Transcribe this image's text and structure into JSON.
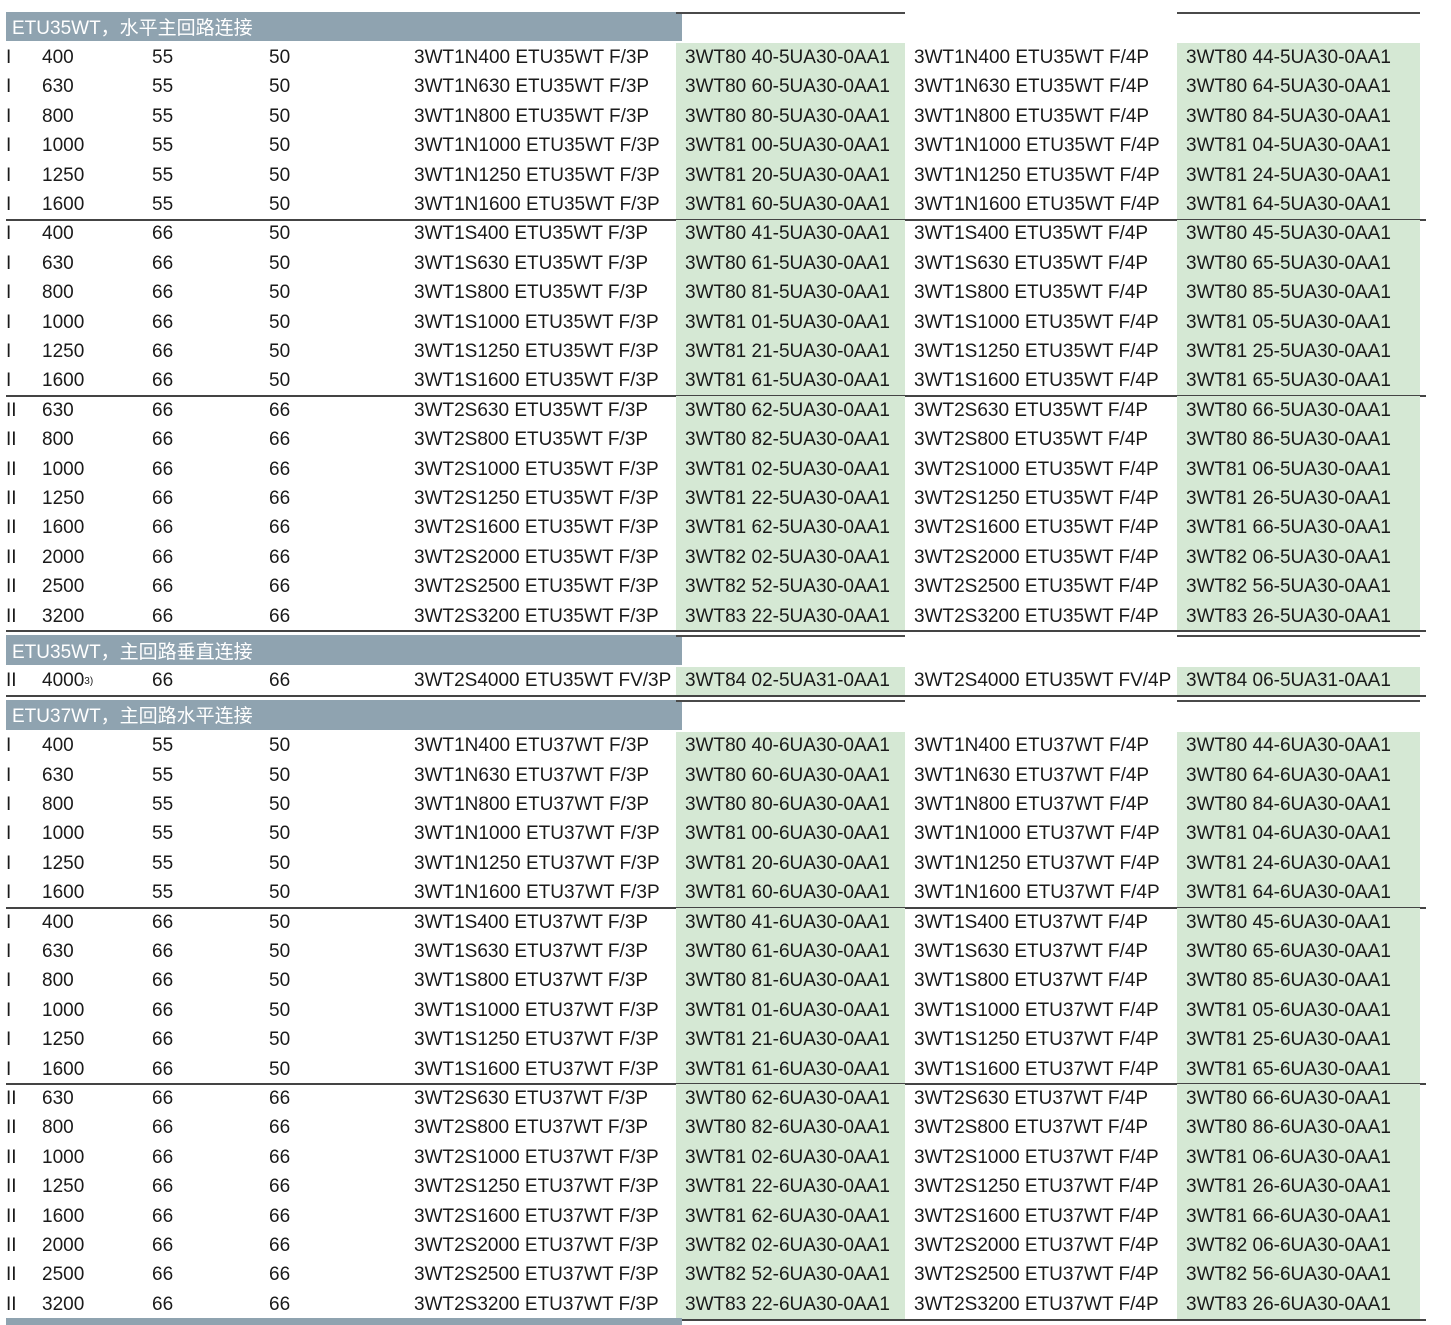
{
  "sections": [
    {
      "title": "ETU35WT，水平主回路连接",
      "groups": [
        [
          [
            "I",
            "400",
            "55",
            "50",
            "3WT1N400 ETU35WT F/3P",
            "3WT80 40-5UA30-0AA1",
            "3WT1N400 ETU35WT F/4P",
            "3WT80 44-5UA30-0AA1"
          ],
          [
            "I",
            "630",
            "55",
            "50",
            "3WT1N630 ETU35WT F/3P",
            "3WT80 60-5UA30-0AA1",
            "3WT1N630 ETU35WT F/4P",
            "3WT80 64-5UA30-0AA1"
          ],
          [
            "I",
            "800",
            "55",
            "50",
            "3WT1N800 ETU35WT F/3P",
            "3WT80 80-5UA30-0AA1",
            "3WT1N800 ETU35WT F/4P",
            "3WT80 84-5UA30-0AA1"
          ],
          [
            "I",
            "1000",
            "55",
            "50",
            "3WT1N1000 ETU35WT F/3P",
            "3WT81 00-5UA30-0AA1",
            "3WT1N1000 ETU35WT F/4P",
            "3WT81 04-5UA30-0AA1"
          ],
          [
            "I",
            "1250",
            "55",
            "50",
            "3WT1N1250 ETU35WT F/3P",
            "3WT81 20-5UA30-0AA1",
            "3WT1N1250 ETU35WT F/4P",
            "3WT81 24-5UA30-0AA1"
          ],
          [
            "I",
            "1600",
            "55",
            "50",
            "3WT1N1600 ETU35WT F/3P",
            "3WT81 60-5UA30-0AA1",
            "3WT1N1600 ETU35WT F/4P",
            "3WT81 64-5UA30-0AA1"
          ]
        ],
        [
          [
            "I",
            "400",
            "66",
            "50",
            "3WT1S400 ETU35WT F/3P",
            "3WT80 41-5UA30-0AA1",
            "3WT1S400 ETU35WT F/4P",
            "3WT80 45-5UA30-0AA1"
          ],
          [
            "I",
            "630",
            "66",
            "50",
            "3WT1S630 ETU35WT F/3P",
            "3WT80 61-5UA30-0AA1",
            "3WT1S630 ETU35WT F/4P",
            "3WT80 65-5UA30-0AA1"
          ],
          [
            "I",
            "800",
            "66",
            "50",
            "3WT1S800 ETU35WT F/3P",
            "3WT80 81-5UA30-0AA1",
            "3WT1S800 ETU35WT F/4P",
            "3WT80 85-5UA30-0AA1"
          ],
          [
            "I",
            "1000",
            "66",
            "50",
            "3WT1S1000 ETU35WT F/3P",
            "3WT81 01-5UA30-0AA1",
            "3WT1S1000 ETU35WT F/4P",
            "3WT81 05-5UA30-0AA1"
          ],
          [
            "I",
            "1250",
            "66",
            "50",
            "3WT1S1250 ETU35WT F/3P",
            "3WT81 21-5UA30-0AA1",
            "3WT1S1250 ETU35WT F/4P",
            "3WT81 25-5UA30-0AA1"
          ],
          [
            "I",
            "1600",
            "66",
            "50",
            "3WT1S1600 ETU35WT F/3P",
            "3WT81 61-5UA30-0AA1",
            "3WT1S1600 ETU35WT F/4P",
            "3WT81 65-5UA30-0AA1"
          ]
        ],
        [
          [
            "II",
            "630",
            "66",
            "66",
            "3WT2S630 ETU35WT F/3P",
            "3WT80 62-5UA30-0AA1",
            "3WT2S630 ETU35WT F/4P",
            "3WT80 66-5UA30-0AA1"
          ],
          [
            "II",
            "800",
            "66",
            "66",
            "3WT2S800 ETU35WT F/3P",
            "3WT80 82-5UA30-0AA1",
            "3WT2S800 ETU35WT F/4P",
            "3WT80 86-5UA30-0AA1"
          ],
          [
            "II",
            "1000",
            "66",
            "66",
            "3WT2S1000 ETU35WT F/3P",
            "3WT81 02-5UA30-0AA1",
            "3WT2S1000 ETU35WT F/4P",
            "3WT81 06-5UA30-0AA1"
          ],
          [
            "II",
            "1250",
            "66",
            "66",
            "3WT2S1250 ETU35WT F/3P",
            "3WT81 22-5UA30-0AA1",
            "3WT2S1250 ETU35WT F/4P",
            "3WT81 26-5UA30-0AA1"
          ],
          [
            "II",
            "1600",
            "66",
            "66",
            "3WT2S1600 ETU35WT F/3P",
            "3WT81 62-5UA30-0AA1",
            "3WT2S1600 ETU35WT F/4P",
            "3WT81 66-5UA30-0AA1"
          ],
          [
            "II",
            "2000",
            "66",
            "66",
            "3WT2S2000 ETU35WT F/3P",
            "3WT82 02-5UA30-0AA1",
            "3WT2S2000 ETU35WT F/4P",
            "3WT82 06-5UA30-0AA1"
          ],
          [
            "II",
            "2500",
            "66",
            "66",
            "3WT2S2500 ETU35WT F/3P",
            "3WT82 52-5UA30-0AA1",
            "3WT2S2500 ETU35WT F/4P",
            "3WT82 56-5UA30-0AA1"
          ],
          [
            "II",
            "3200",
            "66",
            "66",
            "3WT2S3200 ETU35WT F/3P",
            "3WT83 22-5UA30-0AA1",
            "3WT2S3200 ETU35WT F/4P",
            "3WT83 26-5UA30-0AA1"
          ]
        ]
      ]
    },
    {
      "title": "ETU35WT，主回路垂直连接",
      "groups": [
        [
          [
            "II",
            "4000",
            "66",
            "66",
            "3WT2S4000 ETU35WT FV/3P",
            "3WT84 02-5UA31-0AA1",
            "3WT2S4000 ETU35WT FV/4P",
            "3WT84 06-5UA31-0AA1"
          ]
        ]
      ],
      "footnote": "3)"
    },
    {
      "title": "ETU37WT，主回路水平连接",
      "groups": [
        [
          [
            "I",
            "400",
            "55",
            "50",
            "3WT1N400 ETU37WT F/3P",
            "3WT80 40-6UA30-0AA1",
            "3WT1N400 ETU37WT F/4P",
            "3WT80 44-6UA30-0AA1"
          ],
          [
            "I",
            "630",
            "55",
            "50",
            "3WT1N630 ETU37WT F/3P",
            "3WT80 60-6UA30-0AA1",
            "3WT1N630 ETU37WT F/4P",
            "3WT80 64-6UA30-0AA1"
          ],
          [
            "I",
            "800",
            "55",
            "50",
            "3WT1N800 ETU37WT F/3P",
            "3WT80 80-6UA30-0AA1",
            "3WT1N800 ETU37WT F/4P",
            "3WT80 84-6UA30-0AA1"
          ],
          [
            "I",
            "1000",
            "55",
            "50",
            "3WT1N1000 ETU37WT F/3P",
            "3WT81 00-6UA30-0AA1",
            "3WT1N1000 ETU37WT F/4P",
            "3WT81 04-6UA30-0AA1"
          ],
          [
            "I",
            "1250",
            "55",
            "50",
            "3WT1N1250 ETU37WT F/3P",
            "3WT81 20-6UA30-0AA1",
            "3WT1N1250 ETU37WT F/4P",
            "3WT81 24-6UA30-0AA1"
          ],
          [
            "I",
            "1600",
            "55",
            "50",
            "3WT1N1600 ETU37WT F/3P",
            "3WT81 60-6UA30-0AA1",
            "3WT1N1600 ETU37WT F/4P",
            "3WT81 64-6UA30-0AA1"
          ]
        ],
        [
          [
            "I",
            "400",
            "66",
            "50",
            "3WT1S400 ETU37WT F/3P",
            "3WT80 41-6UA30-0AA1",
            "3WT1S400 ETU37WT F/4P",
            "3WT80 45-6UA30-0AA1"
          ],
          [
            "I",
            "630",
            "66",
            "50",
            "3WT1S630 ETU37WT F/3P",
            "3WT80 61-6UA30-0AA1",
            "3WT1S630 ETU37WT F/4P",
            "3WT80 65-6UA30-0AA1"
          ],
          [
            "I",
            "800",
            "66",
            "50",
            "3WT1S800 ETU37WT F/3P",
            "3WT80 81-6UA30-0AA1",
            "3WT1S800 ETU37WT F/4P",
            "3WT80 85-6UA30-0AA1"
          ],
          [
            "I",
            "1000",
            "66",
            "50",
            "3WT1S1000 ETU37WT F/3P",
            "3WT81 01-6UA30-0AA1",
            "3WT1S1000 ETU37WT F/4P",
            "3WT81 05-6UA30-0AA1"
          ],
          [
            "I",
            "1250",
            "66",
            "50",
            "3WT1S1250 ETU37WT F/3P",
            "3WT81 21-6UA30-0AA1",
            "3WT1S1250 ETU37WT F/4P",
            "3WT81 25-6UA30-0AA1"
          ],
          [
            "I",
            "1600",
            "66",
            "50",
            "3WT1S1600 ETU37WT F/3P",
            "3WT81 61-6UA30-0AA1",
            "3WT1S1600 ETU37WT F/4P",
            "3WT81 65-6UA30-0AA1"
          ]
        ],
        [
          [
            "II",
            "630",
            "66",
            "66",
            "3WT2S630 ETU37WT F/3P",
            "3WT80 62-6UA30-0AA1",
            "3WT2S630 ETU37WT F/4P",
            "3WT80 66-6UA30-0AA1"
          ],
          [
            "II",
            "800",
            "66",
            "66",
            "3WT2S800 ETU37WT F/3P",
            "3WT80 82-6UA30-0AA1",
            "3WT2S800 ETU37WT F/4P",
            "3WT80 86-6UA30-0AA1"
          ],
          [
            "II",
            "1000",
            "66",
            "66",
            "3WT2S1000 ETU37WT F/3P",
            "3WT81 02-6UA30-0AA1",
            "3WT2S1000 ETU37WT F/4P",
            "3WT81 06-6UA30-0AA1"
          ],
          [
            "II",
            "1250",
            "66",
            "66",
            "3WT2S1250 ETU37WT F/3P",
            "3WT81 22-6UA30-0AA1",
            "3WT2S1250 ETU37WT F/4P",
            "3WT81 26-6UA30-0AA1"
          ],
          [
            "II",
            "1600",
            "66",
            "66",
            "3WT2S1600 ETU37WT F/3P",
            "3WT81 62-6UA30-0AA1",
            "3WT2S1600 ETU37WT F/4P",
            "3WT81 66-6UA30-0AA1"
          ],
          [
            "II",
            "2000",
            "66",
            "66",
            "3WT2S2000 ETU37WT F/3P",
            "3WT82 02-6UA30-0AA1",
            "3WT2S2000 ETU37WT F/4P",
            "3WT82 06-6UA30-0AA1"
          ],
          [
            "II",
            "2500",
            "66",
            "66",
            "3WT2S2500 ETU37WT F/3P",
            "3WT82 52-6UA30-0AA1",
            "3WT2S2500 ETU37WT F/4P",
            "3WT82 56-6UA30-0AA1"
          ],
          [
            "II",
            "3200",
            "66",
            "66",
            "3WT2S3200 ETU37WT F/3P",
            "3WT83 22-6UA30-0AA1",
            "3WT2S3200 ETU37WT F/4P",
            "3WT83 26-6UA30-0AA1"
          ]
        ]
      ]
    }
  ],
  "colors": {
    "header_bg": "#8fa3b0",
    "order_bg": "#d5e8d4",
    "rule": "#444444"
  }
}
